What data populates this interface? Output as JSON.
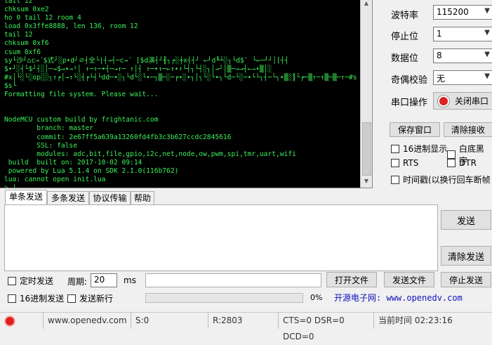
{
  "terminal": {
    "lines": [
      "tail 12",
      "chksum 0xe2",
      "ho 0 tail 12 room 4",
      "load 0x3ffe8888, len 136, room 12",
      "tail 12",
      "chksum 0xf6",
      "csum 0xf6",
      "sy└沙┘⌂c→´$式┘░p∙d┘ㄹ┤全└|┤→┤─c→´ [$d演┤┘╢┐╒░┼x┤┤┘ ←┘d╙┴░┐└d$` └←─┘┘│[┤┤",
      "$∙┘░┤└$┘┤░│─→$→∙→¹│ ↑─↑─∙┤─→↑─ ↑│┤ ↑─∙↑─←↑∙↑└┤┐└┤░┐│→┘│▒─→→┤←→∙▒│░",
      "#x│└░└░op░░┐↑╒│→↑└░┤╒└┤└dd─∙░┐└d└░└∙─┐▒─░─╒∙░∙┐│┐└░└∙┐└d─└░─∙└└┐┤─└┐∙▒░║└╒─▒↑─↑▒─▒─↑─#s",
      "$s└",
      "Formatting file system. Please wait...",
      "",
      "",
      "NodeMCU custom build by frightanic.com",
      "        branch: master",
      "        commit: 2e67ff5a639a13260fd4fb3c3b627ccdc2845616",
      "        SSL: false",
      "        modules: adc,bit,file,gpio,i2c,net,node,ow,pwm,spi,tmr,uart,wifi",
      " build  built on: 2017-10-02 09:14",
      " powered by Lua 5.1.4 on SDK 2.1.0(116b762)",
      "lua: cannot open init.lua",
      "> |"
    ]
  },
  "settings": {
    "baud_label": "波特率",
    "baud_value": "115200",
    "stop_label": "停止位",
    "stop_value": "1",
    "data_label": "数据位",
    "data_value": "8",
    "parity_label": "奇偶校验",
    "parity_value": "无",
    "port_op_label": "串口操作",
    "port_button": "关闭串口"
  },
  "receive": {
    "save_window": "保存窗口",
    "clear_receive": "清除接收",
    "hex_display": "16进制显示",
    "white_black": "白底黑字",
    "rts": "RTS",
    "dtr": "DTR",
    "timestamp": "时间戳(以换行回车断帧"
  },
  "tabs": [
    "单条发送",
    "多条发送",
    "协议传输",
    "帮助"
  ],
  "send": {
    "send_button": "发送",
    "clear_send": "清除发送",
    "timed_send": "定时发送",
    "period_label": "周期:",
    "period_value": "20",
    "period_unit": "ms",
    "open_file": "打开文件",
    "send_file": "发送文件",
    "stop_send": "停止发送",
    "hex_send": "16进制发送",
    "send_newline": "发送新行",
    "progress_text": "0%",
    "progress_value": 0,
    "website_banner": "开源电子网: www.openedv.com"
  },
  "status": {
    "website": "www.openedv.com",
    "sent": "S:0",
    "received": "R:2803",
    "lines": "CTS=0 DSR=0 DCD=0",
    "time": "当前时间 02:23:16"
  },
  "colors": {
    "terminal_bg": "#000000",
    "terminal_fg": "#3cf05a",
    "banner": "#1010c0",
    "record_red": "#e02020"
  }
}
